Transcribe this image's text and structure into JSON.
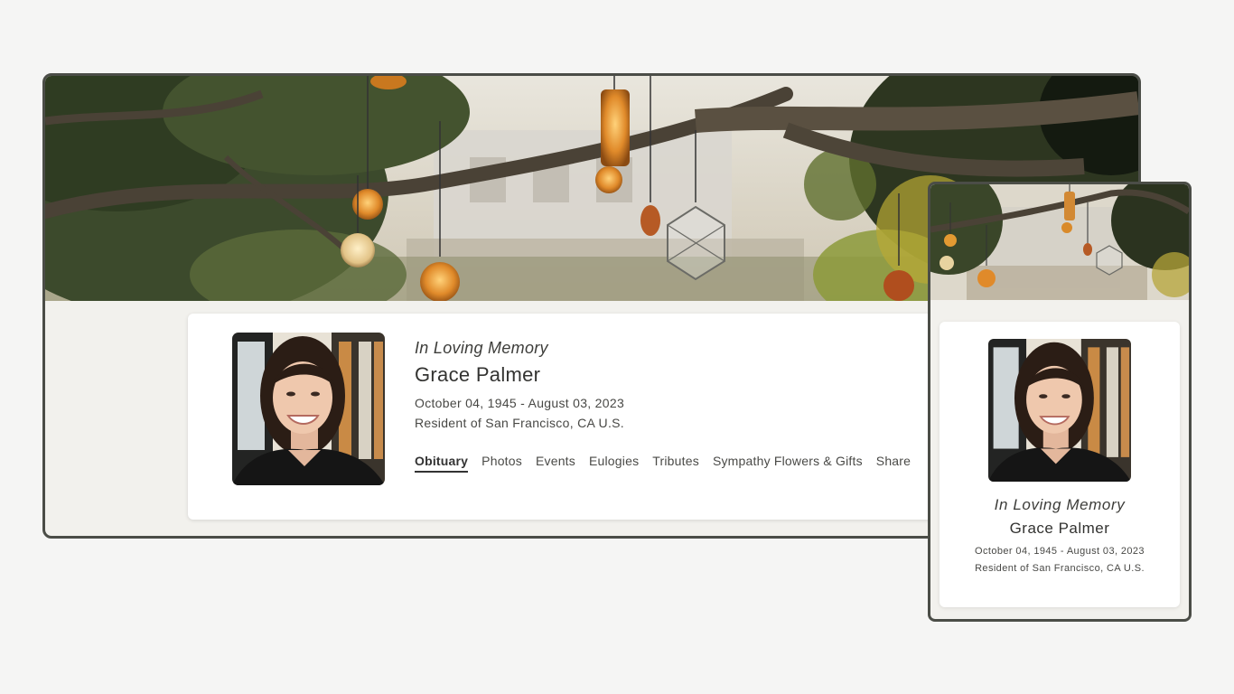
{
  "colors": {
    "page_background": "#f5f5f4",
    "frame_border": "#4b4d47",
    "frame_background": "#f2f1ed",
    "card_background": "#ffffff",
    "text": "#3a3a38"
  },
  "desktop": {
    "banner_image": "tree-lanterns-banner",
    "profile": {
      "photo": "portrait-photo",
      "heading": "In Loving Memory",
      "name": "Grace Palmer",
      "dates": "October 04, 1945 - August 03, 2023",
      "residence": "Resident of San Francisco, CA U.S."
    },
    "tabs": [
      {
        "label": "Obituary",
        "active": true
      },
      {
        "label": "Photos",
        "active": false
      },
      {
        "label": "Events",
        "active": false
      },
      {
        "label": "Eulogies",
        "active": false
      },
      {
        "label": "Tributes",
        "active": false
      },
      {
        "label": "Sympathy Flowers & Gifts",
        "active": false
      },
      {
        "label": "Share",
        "active": false
      }
    ]
  },
  "mobile": {
    "banner_image": "tree-lanterns-banner",
    "profile": {
      "photo": "portrait-photo",
      "heading": "In Loving Memory",
      "name": "Grace Palmer",
      "dates": "October 04, 1945 - August 03, 2023",
      "residence": "Resident of San Francisco, CA U.S."
    }
  }
}
